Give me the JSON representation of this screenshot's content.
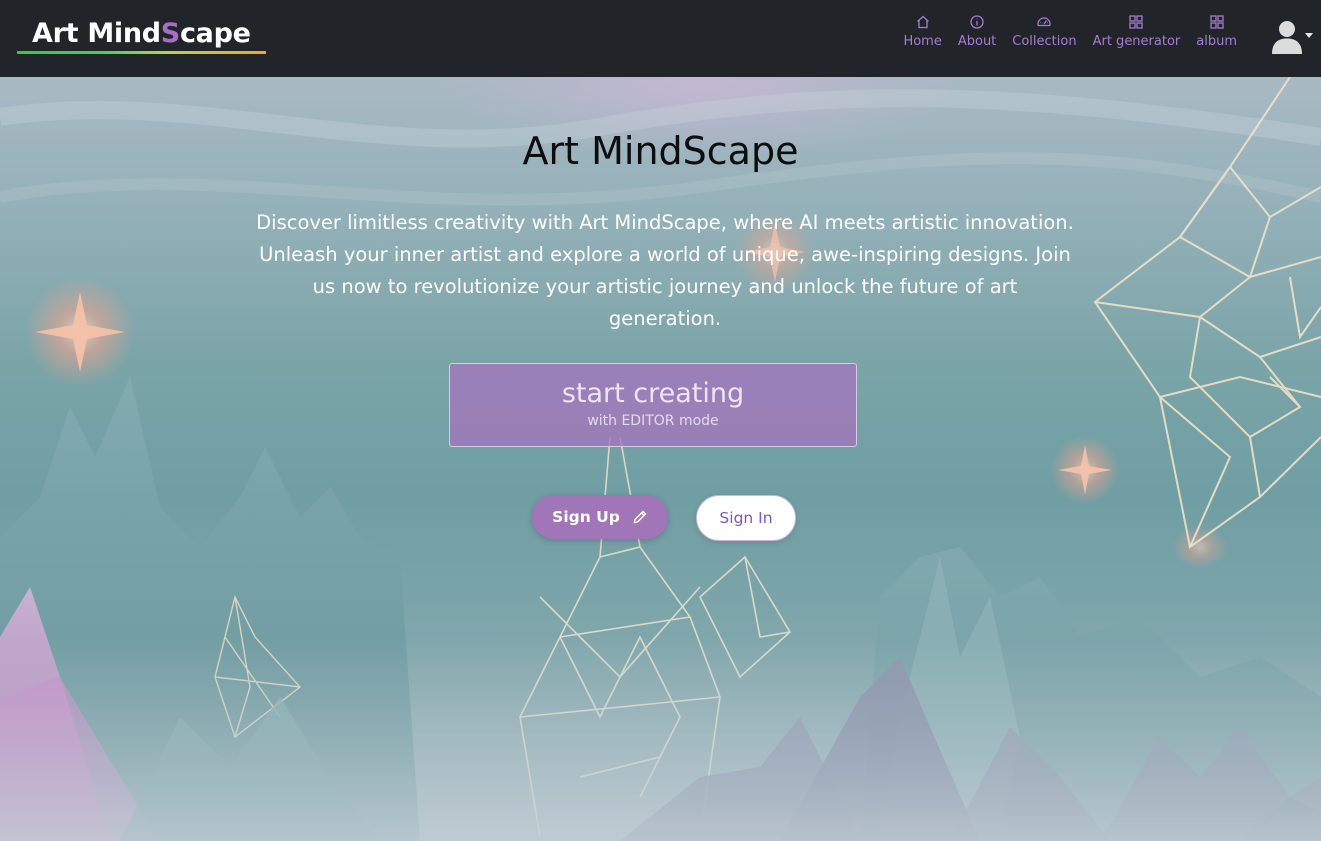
{
  "brand": {
    "text_before": "Art Mind",
    "text_accent": "S",
    "text_after": "cape"
  },
  "nav": {
    "items": [
      {
        "label": "Home",
        "icon": "home-icon"
      },
      {
        "label": "About",
        "icon": "info-icon"
      },
      {
        "label": "Collection",
        "icon": "speedometer-icon"
      },
      {
        "label": "Art generator",
        "icon": "grid-icon"
      },
      {
        "label": "album",
        "icon": "grid-icon"
      }
    ],
    "avatar_icon": "user-avatar-icon"
  },
  "hero": {
    "title": "Art MindScape",
    "description": "Discover limitless creativity with Art MindScape, where AI meets artistic innovation. Unleash your inner artist and explore a world of unique, awe-inspiring designs. Join us now to revolutionize your artistic journey and unlock the future of art generation.",
    "start_button": {
      "label": "start creating",
      "sublabel": "with EDITOR mode"
    },
    "signup_button": {
      "label": "Sign Up",
      "icon": "pencil-icon"
    },
    "signin_button": {
      "label": "Sign In"
    }
  },
  "colors": {
    "navbar_bg": "#212529",
    "nav_link": "#a77bd0",
    "accent_purple": "#a176b8",
    "signin_text": "#7e57c2"
  }
}
